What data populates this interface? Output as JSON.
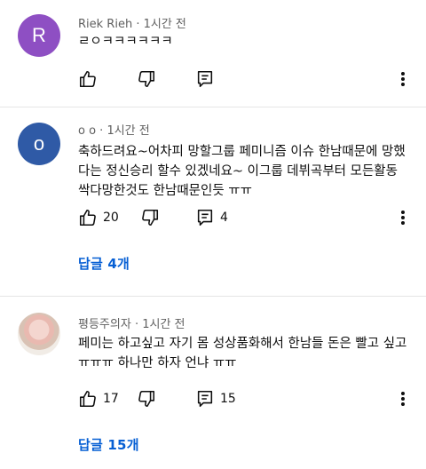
{
  "colors": {
    "avatar1": "#8e4fc3",
    "avatar2": "#2f5aa6",
    "link": "#065fd4",
    "meta": "#606060",
    "divider": "#e5e5e5"
  },
  "comments": [
    {
      "avatar_letter": "R",
      "author": "Riek Rieh",
      "time": "1시간 전",
      "text": "ㄹㅇㅋㅋㅋㅋㅋㅋ",
      "likes": "",
      "replies_count": "",
      "replies_link": ""
    },
    {
      "avatar_letter": "o",
      "author": "o o",
      "time": "1시간 전",
      "text": "축하드려요~어차피 망할그룹 페미니즘 이슈 한남때문에 망했다는 정신승리 할수 있겠네요~ 이그룹 데뷔곡부터 모든활동 싹다망한것도 한남때문인듯 ㅠㅠ",
      "likes": "20",
      "replies_count": "4",
      "replies_link": "답글 4개"
    },
    {
      "avatar_letter": "",
      "author": "평등주의자",
      "time": "1시간 전",
      "text": "페미는 하고싶고 자기 몸 성상품화해서 한남들 돈은 빨고 싶고 ㅠㅠㅠ 하나만 하자 언냐 ㅠㅠ",
      "likes": "17",
      "replies_count": "15",
      "replies_link": "답글 15개"
    }
  ],
  "icons": {
    "like": "thumbs-up-icon",
    "dislike": "thumbs-down-icon",
    "reply": "comment-reply-icon",
    "more": "more-vertical-icon"
  }
}
